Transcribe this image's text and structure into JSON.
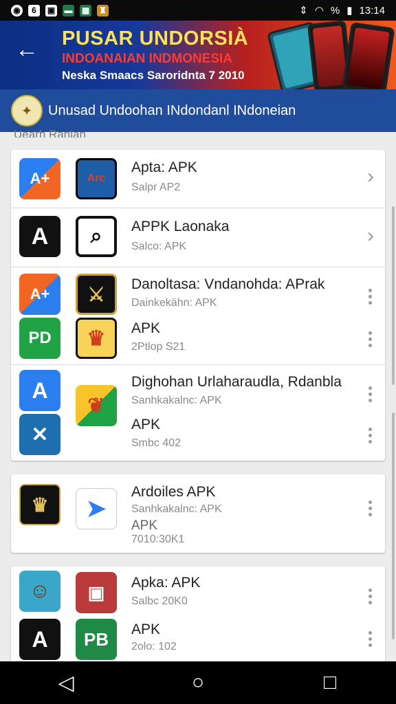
{
  "status_bar": {
    "time": "13:14",
    "battery": "%"
  },
  "banner": {
    "title": "PUSAR UNDORSIÀ",
    "subtitle": "INDOANAIAN INDMONESIA",
    "tagline": "Neska Smaacs Saroridnta 7 2010"
  },
  "subheader": {
    "title": "Unusad Undoohan INdondanl INdoneian"
  },
  "section_label": "Uearh Ranian",
  "apps": [
    {
      "title": "Apta: APK",
      "subtitle": "Salpr AP2"
    },
    {
      "title": "APPK Laonaka",
      "subtitle": "Salco: APK"
    },
    {
      "title": "Danoltasa: Vndanohda: APrak",
      "subtitle": "Dainkekähn: APK"
    },
    {
      "title": "APK",
      "subtitle": "2Ptlop S21"
    },
    {
      "title": "Dighohan Urlaharaudla, Rdanbla",
      "subtitle": "Sanhkakalnc: APK"
    },
    {
      "title": "APK",
      "subtitle": "Smbc 402"
    },
    {
      "title": "Ardoiles APK",
      "subtitle": "Sanhkakalnc: APK",
      "extra": "APK",
      "extra2": "7010:30K1"
    },
    {
      "title": "Apka: APK",
      "subtitle": "Salbc 20K0"
    },
    {
      "title": "APK",
      "subtitle": "2olo: 102"
    }
  ],
  "icon_labels": {
    "aplus": "A+",
    "arc": "Arc",
    "pd": "PD",
    "pb": "PB"
  },
  "colors": {
    "banner_blue": "#0b2f83",
    "subhead": "#1f4d9c",
    "accent_orange": "#f26522"
  }
}
